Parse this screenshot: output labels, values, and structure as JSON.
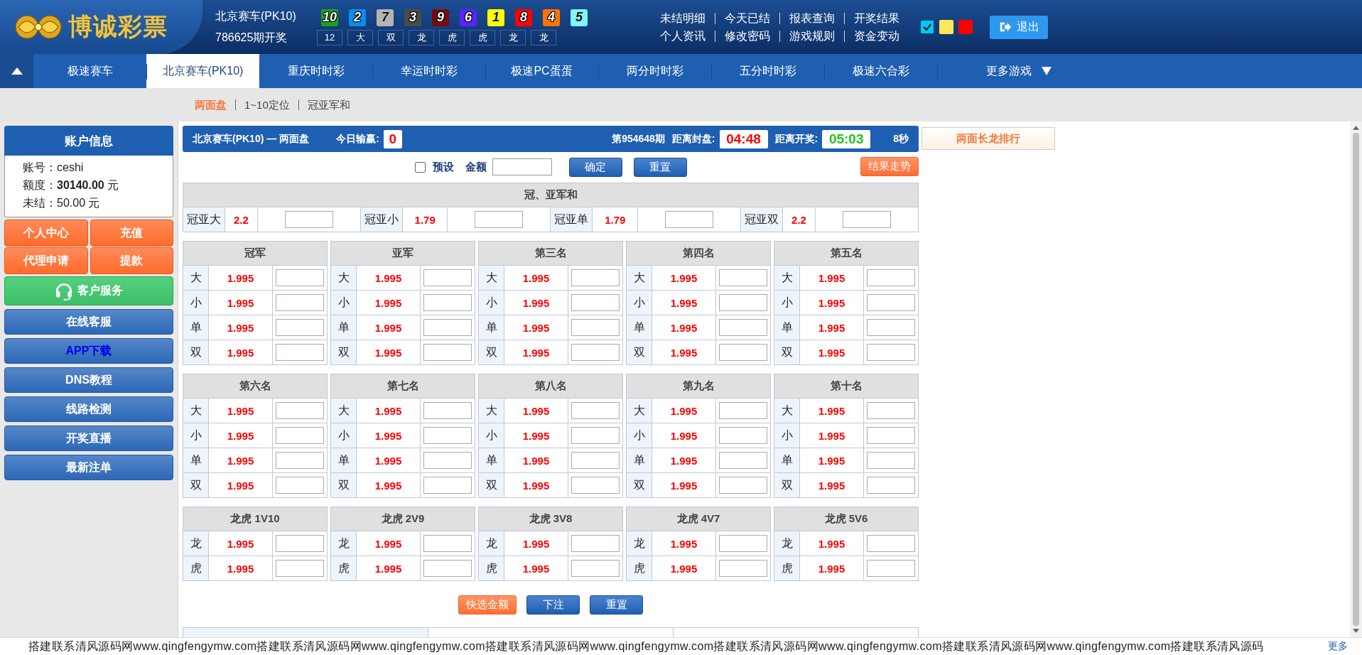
{
  "header": {
    "logo": "博诚彩票",
    "lottery": "北京赛车(PK10)",
    "draw": "786625期开奖",
    "balls": [
      {
        "number": "10",
        "color": "#1aa31a"
      },
      {
        "number": "2",
        "color": "#0d8cf0"
      },
      {
        "number": "7",
        "color": "#b4b4b4"
      },
      {
        "number": "3",
        "color": "#4a4a4a"
      },
      {
        "number": "9",
        "color": "#7a0a0a"
      },
      {
        "number": "6",
        "color": "#5a22ff"
      },
      {
        "number": "1",
        "color": "#ffff00"
      },
      {
        "number": "8",
        "color": "#ff0000"
      },
      {
        "number": "4",
        "color": "#ff7300"
      },
      {
        "number": "5",
        "color": "#7ff5ff"
      }
    ],
    "results": [
      "12",
      "大",
      "双",
      "龙",
      "虎",
      "虎",
      "龙",
      "龙"
    ],
    "links": [
      [
        "未结明细",
        "今天已结",
        "报表查询",
        "开奖结果"
      ],
      [
        "个人资讯",
        "修改密码",
        "游戏规则",
        "资金变动"
      ]
    ],
    "themes": [
      {
        "color": "#00c8ff",
        "selected": true
      },
      {
        "color": "#ffe95a",
        "selected": false
      },
      {
        "color": "#ff0000",
        "selected": false
      }
    ],
    "logout": "退出"
  },
  "nav": {
    "tabs": [
      {
        "label": "极速赛车",
        "selected": false,
        "has_menu": false
      },
      {
        "label": "北京赛车(PK10)",
        "selected": true,
        "has_menu": false
      },
      {
        "label": "重庆时时彩",
        "selected": false,
        "has_menu": false
      },
      {
        "label": "幸运时时彩",
        "selected": false,
        "has_menu": false
      },
      {
        "label": "极速PC蛋蛋",
        "selected": false,
        "has_menu": false
      },
      {
        "label": "两分时时彩",
        "selected": false,
        "has_menu": false
      },
      {
        "label": "五分时时彩",
        "selected": false,
        "has_menu": false
      },
      {
        "label": "极速六合彩",
        "selected": false,
        "has_menu": false
      },
      {
        "label": "更多游戏",
        "selected": false,
        "has_menu": true
      }
    ]
  },
  "subtabs": [
    {
      "label": "两面盘",
      "selected": true
    },
    {
      "label": "1~10定位",
      "selected": false
    },
    {
      "label": "冠亚军和",
      "selected": false
    }
  ],
  "account": {
    "title": "账户信息",
    "fields": [
      {
        "label": "账号：",
        "value": "ceshi"
      },
      {
        "label": "额度：",
        "value": "**30140.00** 元"
      },
      {
        "label": "未结：",
        "value": "50.00 元"
      }
    ]
  },
  "sidebar_buttons": [
    {
      "label": "个人中心",
      "kind": "orange"
    },
    {
      "label": "充值",
      "kind": "orange"
    },
    {
      "label": "代理申请",
      "kind": "orange"
    },
    {
      "label": "提款",
      "kind": "orange"
    },
    {
      "label": "客户服务",
      "kind": "service"
    },
    {
      "label": "在线客服",
      "kind": "blue"
    },
    {
      "label": "APP下载",
      "kind": "accent"
    },
    {
      "label": "DNS教程",
      "kind": "blue"
    },
    {
      "label": "线路检测",
      "kind": "blue"
    },
    {
      "label": "开奖直播",
      "kind": "blue"
    },
    {
      "label": "最新注单",
      "kind": "blue"
    }
  ],
  "board": {
    "title": "北京赛车(PK10) — 两面盘",
    "profit_label": "今日输赢:",
    "profit": "0",
    "period": "第954648期",
    "timers": [
      {
        "label": "距离封盘:",
        "value": "04:48",
        "color": "#ff0000"
      },
      {
        "label": "距离开奖:",
        "value": "05:03",
        "color": "#22c322"
      }
    ],
    "countdown": "8秒"
  },
  "side_panel": {
    "title": "两面长龙排行"
  },
  "controls": {
    "preset": {
      "label": "预设",
      "checked": false
    },
    "amount_label": "金额",
    "buttons": [
      "确定",
      "重置"
    ],
    "trend": "结果走势"
  },
  "sum_table": {
    "title": "冠、亚军和",
    "items": [
      {
        "label": "冠亚大",
        "odds": "2.2"
      },
      {
        "label": "冠亚小",
        "odds": "1.79"
      },
      {
        "label": "冠亚单",
        "odds": "1.79"
      },
      {
        "label": "冠亚双",
        "odds": "2.2"
      }
    ]
  },
  "groups": [
    {
      "title": "冠军",
      "rows": [
        {
          "label": "大",
          "odds": "1.995"
        },
        {
          "label": "小",
          "odds": "1.995"
        },
        {
          "label": "单",
          "odds": "1.995"
        },
        {
          "label": "双",
          "odds": "1.995"
        }
      ]
    },
    {
      "title": "亚军",
      "rows": [
        {
          "label": "大",
          "odds": "1.995"
        },
        {
          "label": "小",
          "odds": "1.995"
        },
        {
          "label": "单",
          "odds": "1.995"
        },
        {
          "label": "双",
          "odds": "1.995"
        }
      ]
    },
    {
      "title": "第三名",
      "rows": [
        {
          "label": "大",
          "odds": "1.995"
        },
        {
          "label": "小",
          "odds": "1.995"
        },
        {
          "label": "单",
          "odds": "1.995"
        },
        {
          "label": "双",
          "odds": "1.995"
        }
      ]
    },
    {
      "title": "第四名",
      "rows": [
        {
          "label": "大",
          "odds": "1.995"
        },
        {
          "label": "小",
          "odds": "1.995"
        },
        {
          "label": "单",
          "odds": "1.995"
        },
        {
          "label": "双",
          "odds": "1.995"
        }
      ]
    },
    {
      "title": "第五名",
      "rows": [
        {
          "label": "大",
          "odds": "1.995"
        },
        {
          "label": "小",
          "odds": "1.995"
        },
        {
          "label": "单",
          "odds": "1.995"
        },
        {
          "label": "双",
          "odds": "1.995"
        }
      ]
    },
    {
      "title": "第六名",
      "rows": [
        {
          "label": "大",
          "odds": "1.995"
        },
        {
          "label": "小",
          "odds": "1.995"
        },
        {
          "label": "单",
          "odds": "1.995"
        },
        {
          "label": "双",
          "odds": "1.995"
        }
      ]
    },
    {
      "title": "第七名",
      "rows": [
        {
          "label": "大",
          "odds": "1.995"
        },
        {
          "label": "小",
          "odds": "1.995"
        },
        {
          "label": "单",
          "odds": "1.995"
        },
        {
          "label": "双",
          "odds": "1.995"
        }
      ]
    },
    {
      "title": "第八名",
      "rows": [
        {
          "label": "大",
          "odds": "1.995"
        },
        {
          "label": "小",
          "odds": "1.995"
        },
        {
          "label": "单",
          "odds": "1.995"
        },
        {
          "label": "双",
          "odds": "1.995"
        }
      ]
    },
    {
      "title": "第九名",
      "rows": [
        {
          "label": "大",
          "odds": "1.995"
        },
        {
          "label": "小",
          "odds": "1.995"
        },
        {
          "label": "单",
          "odds": "1.995"
        },
        {
          "label": "双",
          "odds": "1.995"
        }
      ]
    },
    {
      "title": "第十名",
      "rows": [
        {
          "label": "大",
          "odds": "1.995"
        },
        {
          "label": "小",
          "odds": "1.995"
        },
        {
          "label": "单",
          "odds": "1.995"
        },
        {
          "label": "双",
          "odds": "1.995"
        }
      ]
    },
    {
      "title": "龙虎 1V10",
      "rows": [
        {
          "label": "龙",
          "odds": "1.995"
        },
        {
          "label": "虎",
          "odds": "1.995"
        }
      ]
    },
    {
      "title": "龙虎 2V9",
      "rows": [
        {
          "label": "龙",
          "odds": "1.995"
        },
        {
          "label": "虎",
          "odds": "1.995"
        }
      ]
    },
    {
      "title": "龙虎 3V8",
      "rows": [
        {
          "label": "龙",
          "odds": "1.995"
        },
        {
          "label": "虎",
          "odds": "1.995"
        }
      ]
    },
    {
      "title": "龙虎 4V7",
      "rows": [
        {
          "label": "龙",
          "odds": "1.995"
        },
        {
          "label": "虎",
          "odds": "1.995"
        }
      ]
    },
    {
      "title": "龙虎 5V6",
      "rows": [
        {
          "label": "龙",
          "odds": "1.995"
        },
        {
          "label": "虎",
          "odds": "1.995"
        }
      ]
    }
  ],
  "actions": [
    {
      "label": "快选金额",
      "kind": "orange"
    },
    {
      "label": "下注",
      "kind": "blue"
    },
    {
      "label": "重置",
      "kind": "blue"
    }
  ],
  "ticker": {
    "text": "搭建联系清风源码网www.qingfengymw.com搭建联系清风源码网www.qingfengymw.com搭建联系清风源码网www.qingfengymw.com搭建联系清风源码网www.qingfengymw.com搭建联系清风源码网www.qingfengymw.com搭建联系清风源码",
    "more": "更多"
  }
}
